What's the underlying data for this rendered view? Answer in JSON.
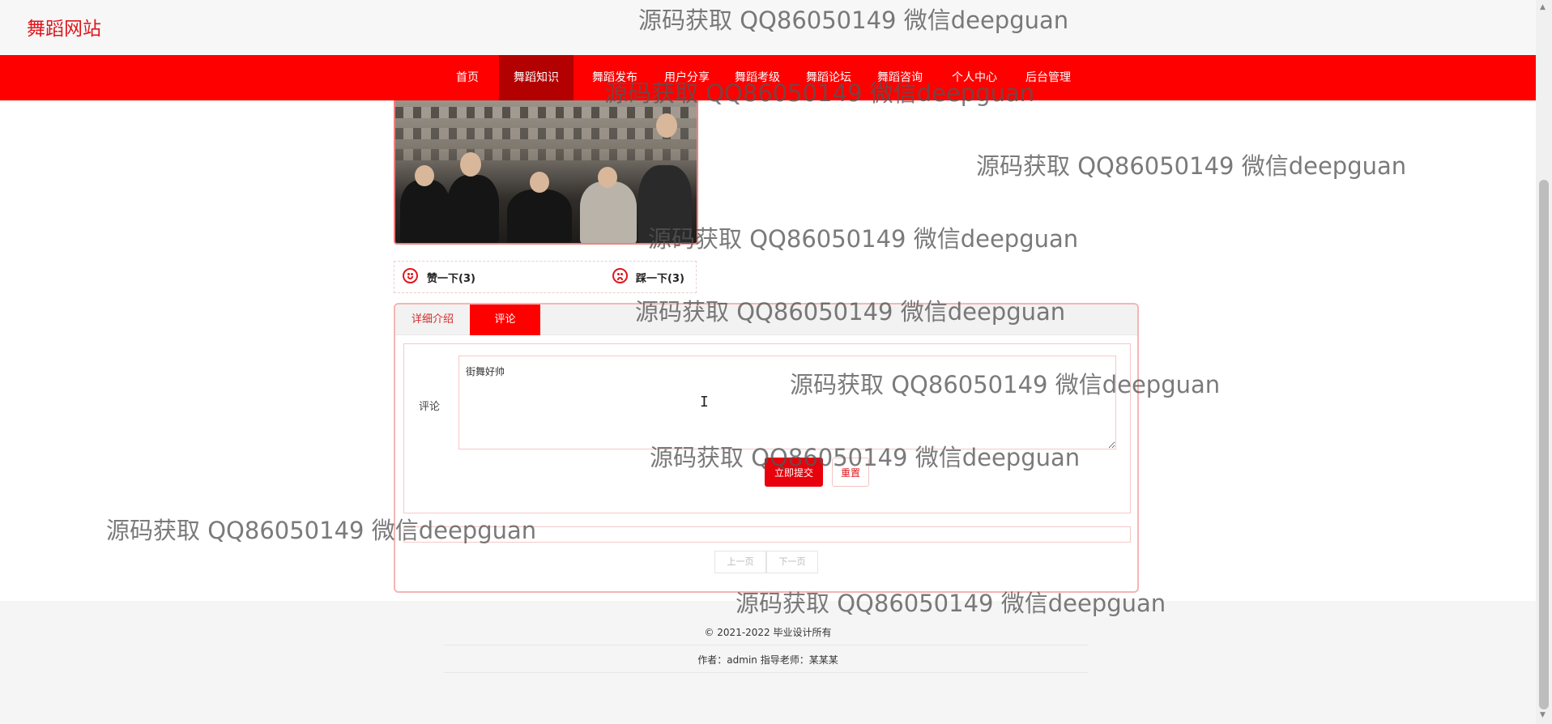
{
  "site": {
    "title": "舞蹈网站"
  },
  "nav": {
    "items": [
      "首页",
      "舞蹈知识",
      "舞蹈发布",
      "用户分享",
      "舞蹈考级",
      "舞蹈论坛",
      "舞蹈咨询",
      "个人中心",
      "后台管理"
    ],
    "active_index": 1
  },
  "vote": {
    "like_label": "赞一下(3)",
    "dislike_label": "踩一下(3)"
  },
  "tabs": {
    "detail": "详细介绍",
    "comment": "评论"
  },
  "comment_form": {
    "label": "评论",
    "value": "街舞好帅",
    "submit_label": "立即提交",
    "reset_label": "重置"
  },
  "pager": {
    "prev": "上一页",
    "next": "下一页"
  },
  "footer": {
    "copyright": "© 2021-2022 毕业设计所有",
    "author": "作者：admin 指导老师：某某某"
  },
  "watermark": "源码获取 QQ86050149 微信deepguan",
  "colors": {
    "brand_red": "#ff0000",
    "active_nav": "#b30000",
    "title_red": "#e0161c"
  }
}
